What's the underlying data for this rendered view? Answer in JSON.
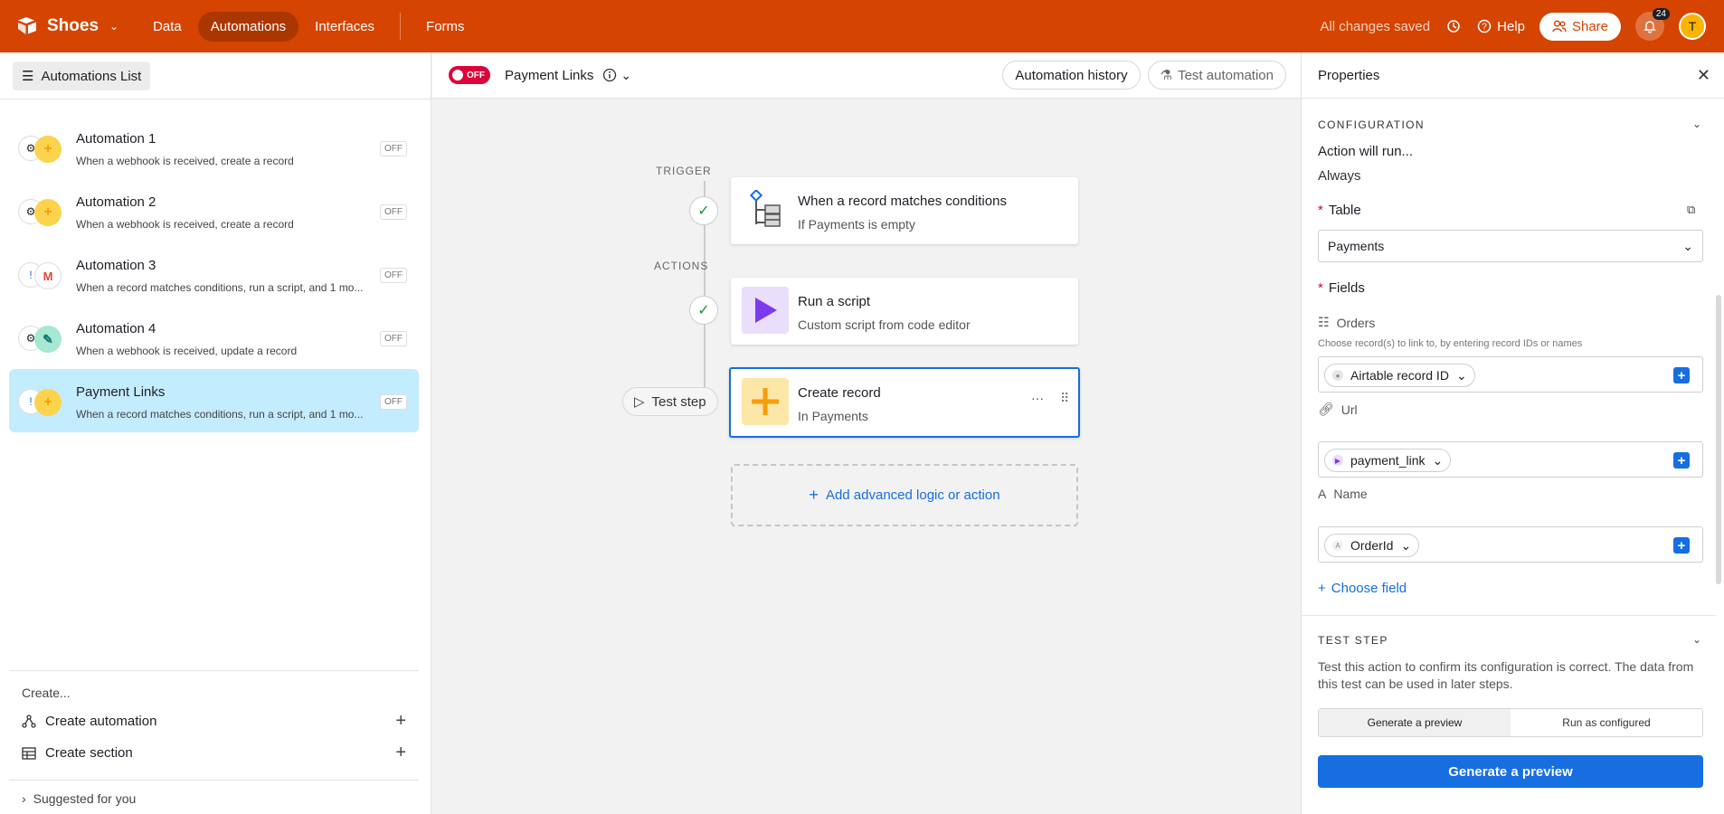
{
  "topbar": {
    "base_name": "Shoes",
    "nav": [
      "Data",
      "Automations",
      "Interfaces",
      "Forms"
    ],
    "status": "All changes saved",
    "help": "Help",
    "share": "Share",
    "notifications": "24",
    "avatar": "T",
    "brand_color": "#d54400"
  },
  "sidebar": {
    "list_button": "Automations List",
    "automations": [
      {
        "title": "Automation 1",
        "desc": "When a webhook is received, create a record",
        "status": "OFF",
        "icon2": "+",
        "icon2_color": "#fcd34d"
      },
      {
        "title": "Automation 2",
        "desc": "When a webhook is received, create a record",
        "status": "OFF",
        "icon2": "+",
        "icon2_color": "#fcd34d"
      },
      {
        "title": "Automation 3",
        "desc": "When a record matches conditions, run a script, and 1 mo...",
        "status": "OFF",
        "icon2": "M",
        "icon2_color": "#ffffff"
      },
      {
        "title": "Automation 4",
        "desc": "When a webhook is received, update a record",
        "status": "OFF",
        "icon2": "✎",
        "icon2_color": "#a7e8d3"
      },
      {
        "title": "Payment Links",
        "desc": "When a record matches conditions, run a script, and 1 mo...",
        "status": "OFF",
        "icon2": "+",
        "icon2_color": "#fcd34d"
      }
    ],
    "create_header": "Create...",
    "create_automation": "Create automation",
    "create_section": "Create section",
    "suggested": "Suggested for you"
  },
  "canvas": {
    "toggle_label": "OFF",
    "automation_name": "Payment Links",
    "history_button": "Automation history",
    "test_button": "Test automation",
    "trigger_label": "TRIGGER",
    "actions_label": "ACTIONS",
    "trigger_card": {
      "title": "When a record matches conditions",
      "subtitle": "If Payments is empty"
    },
    "script_card": {
      "title": "Run a script",
      "subtitle": "Custom script from code editor"
    },
    "create_card": {
      "title": "Create record",
      "subtitle": "In Payments"
    },
    "test_step": "Test step",
    "add_logic": "Add advanced logic or action"
  },
  "properties": {
    "title": "Properties",
    "configuration": "CONFIGURATION",
    "action_will_run": "Action will run...",
    "always": "Always",
    "table_label": "Table",
    "table_value": "Payments",
    "fields_label": "Fields",
    "orders_label": "Orders",
    "orders_hint": "Choose record(s) to link to, by entering record IDs or names",
    "orders_token": "Airtable record ID",
    "url_label": "Url",
    "url_token": "payment_link",
    "name_label": "Name",
    "name_token": "OrderId",
    "choose_field": "Choose field",
    "test_step_header": "TEST STEP",
    "test_step_desc": "Test this action to confirm its configuration is correct. The data from this test can be used in later steps.",
    "seg_preview": "Generate a preview",
    "seg_run": "Run as configured",
    "generate_button": "Generate a preview"
  }
}
